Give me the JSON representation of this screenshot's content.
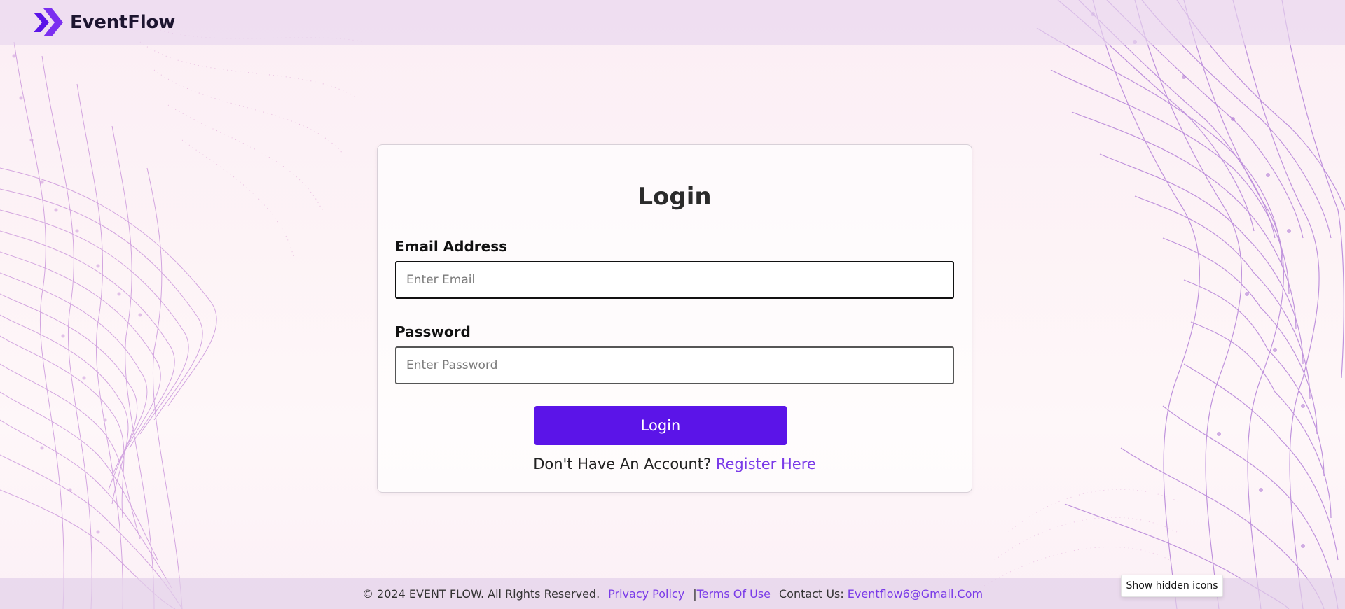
{
  "header": {
    "brand": "EventFlow",
    "logo_icon": "double-chevron-right-icon"
  },
  "login_card": {
    "title": "Login",
    "email_label": "Email Address",
    "email_placeholder": "Enter Email",
    "email_value": "",
    "password_label": "Password",
    "password_placeholder": "Enter Password",
    "password_value": "",
    "submit_label": "Login",
    "register_prompt": "Don't Have An Account?",
    "register_link": "Register Here"
  },
  "footer": {
    "copyright": "© 2024 EVENT FLOW. All Rights Reserved.",
    "privacy": "Privacy Policy",
    "separator": "|",
    "terms": "Terms Of Use",
    "contact_label": "Contact Us:",
    "contact_email": "Eventflow6@Gmail.Com"
  },
  "tray_tooltip": "Show hidden icons",
  "colors": {
    "accent": "#5b14e8",
    "link": "#7a3be8",
    "mesh": "#b47fd8",
    "header_bg": "#e8d6ee"
  }
}
